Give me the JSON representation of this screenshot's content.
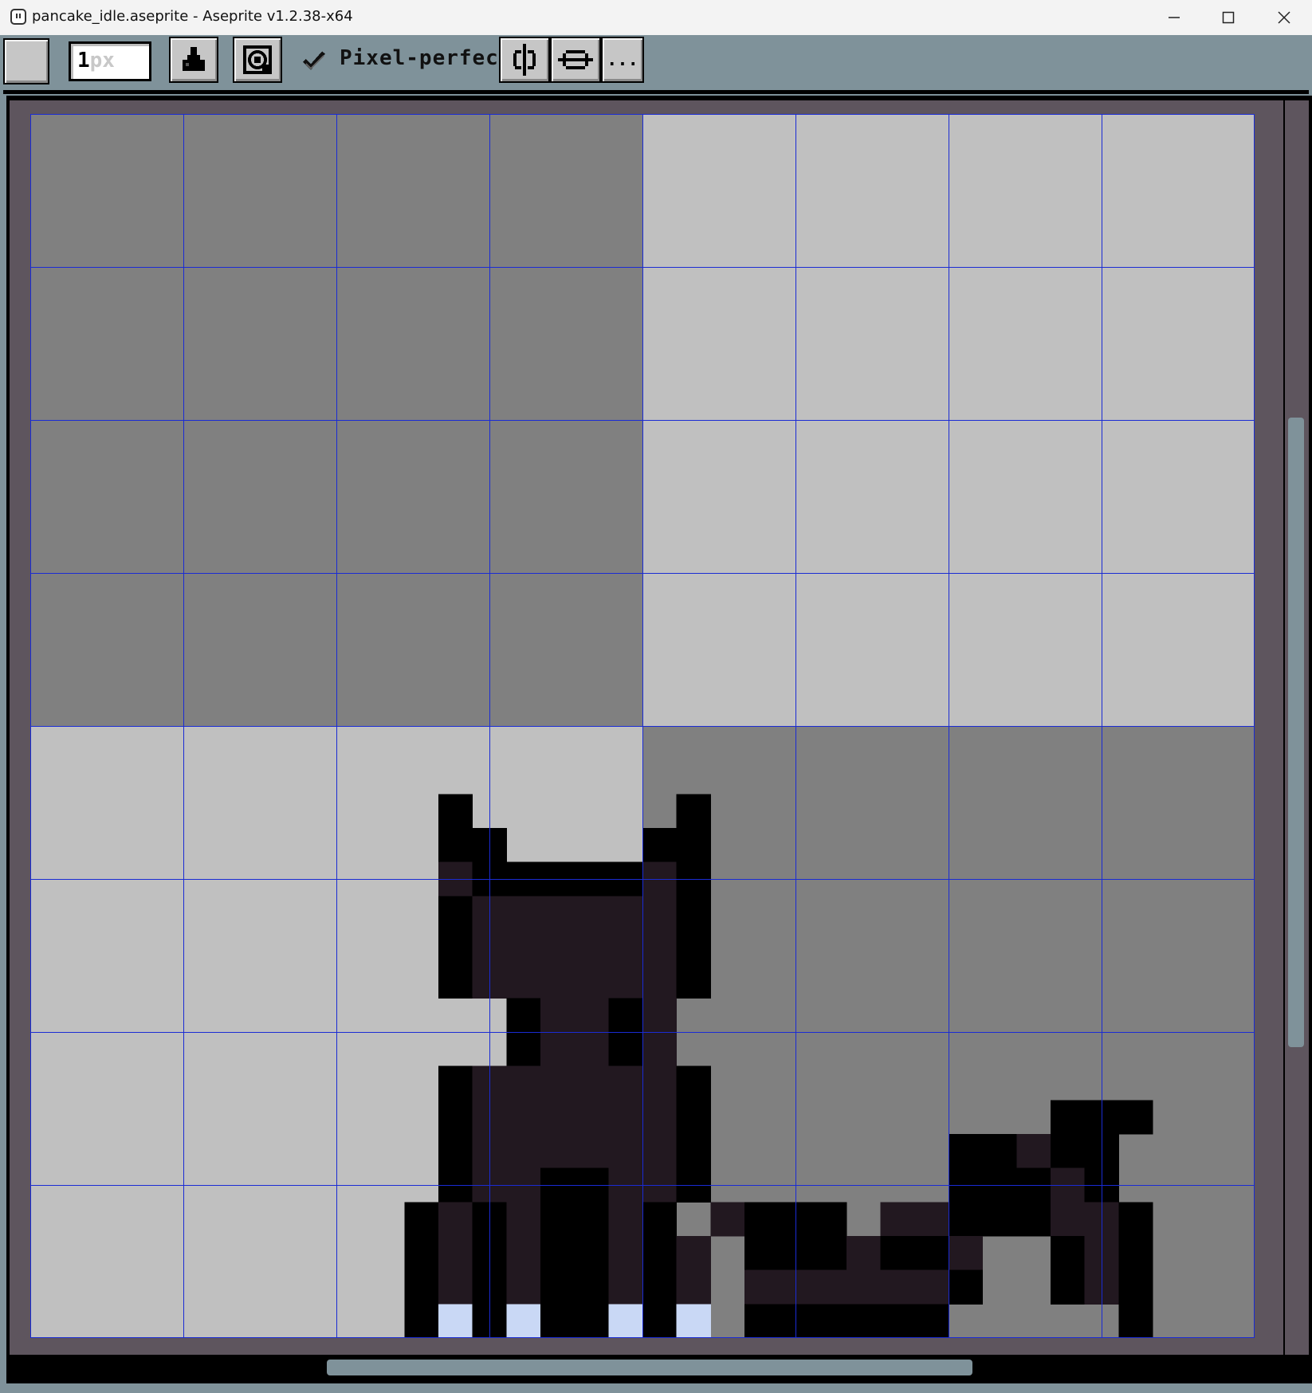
{
  "window": {
    "title": "pancake_idle.aseprite - Aseprite v1.2.38-x64",
    "controls": [
      "minimize",
      "maximize",
      "close"
    ]
  },
  "toolbar": {
    "brush_size": "1",
    "brush_unit": "px",
    "ink_icon": "ink-bucket-icon",
    "options_icon": "brush-options-icon",
    "pixel_perfect_checked": true,
    "pixel_perfect_label": "Pixel-perfect",
    "symmetry_vertical_icon": "symmetry-vertical-icon",
    "symmetry_horizontal_icon": "symmetry-horizontal-icon",
    "more_label": "..."
  },
  "canvas": {
    "grid_color": "#1a2bd4",
    "checker_dark": "#808080",
    "checker_light": "#c0c0c0",
    "palette": {
      "K": "#000000",
      "D": "#221820",
      "W": "#c9d8f5"
    },
    "pixels": [
      "................................",
      "................................",
      "................................",
      "................................",
      "................................",
      "................................",
      "................................",
      "................................",
      "................................",
      "................................",
      "................................",
      "................................",
      "................................",
      "................................",
      "................................",
      "................................",
      "................................",
      "................................",
      "................................",
      "................................",
      "............K......K............",
      "............KK....KK............",
      "............DKKKKKDK............",
      "............KDDDDDDK............",
      "............KDDDDDDK............",
      "............KDDDDDDK............",
      "..............KDDKD.............",
      "..............KDDKD.............",
      "............KDDDDDDK............",
      "............KDDDDDDK..........KKK",
      "............KDDDDDDK.......KKDKK.",
      "............KDDKKDDK.......KKKDK.",
      "...........KDKDKKDK.DKKK.DDKKKDDK",
      "...........KDKDKKDKD.KKKDKKD..KDK",
      "...........KDKDKKDKD.DDDDDDK..KDK",
      "...........KWKWKKWKW.KKKKKK.....K"
    ]
  },
  "scrollbars": {
    "vertical_thumb_fraction": 0.5,
    "horizontal_thumb_fraction": 0.5
  }
}
